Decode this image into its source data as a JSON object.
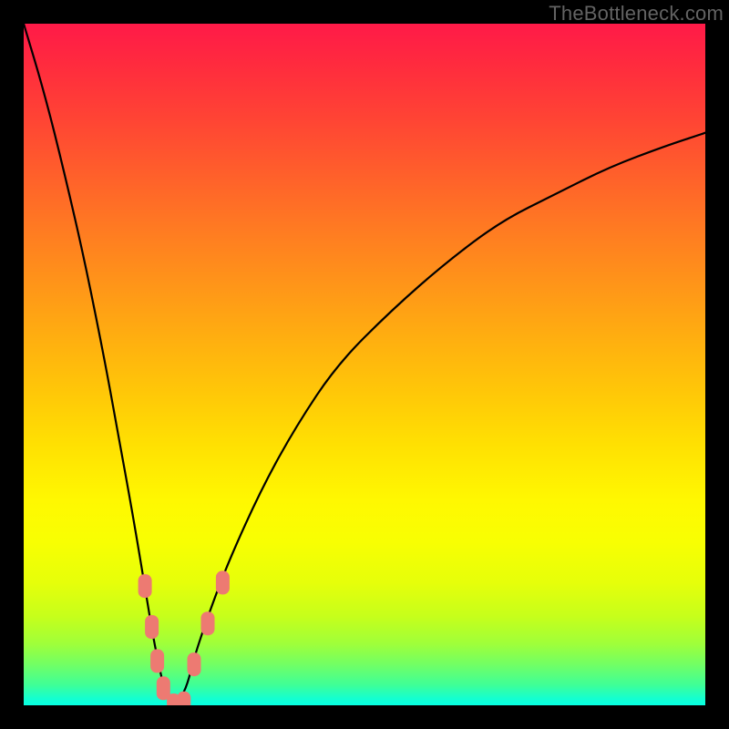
{
  "watermark": {
    "text": "TheBottleneck.com"
  },
  "chart_data": {
    "type": "line",
    "title": "",
    "xlabel": "",
    "ylabel": "",
    "xlim": [
      0,
      100
    ],
    "ylim": [
      0,
      100
    ],
    "grid": false,
    "legend": false,
    "description": "V-shaped bottleneck curve (black) over rainbow gradient; minimum near x≈22.",
    "series": [
      {
        "name": "bottleneck-curve",
        "color": "#000000",
        "x": [
          0,
          3,
          6,
          9,
          12,
          14,
          16,
          18,
          19,
          20,
          21,
          22,
          23,
          24,
          25,
          27,
          30,
          35,
          40,
          46,
          54,
          62,
          70,
          78,
          86,
          94,
          100
        ],
        "y": [
          100,
          90,
          78,
          65,
          50,
          39,
          28,
          16,
          10,
          5,
          1,
          0,
          1,
          3,
          7,
          13,
          21,
          32,
          41,
          50,
          58,
          65,
          71,
          75,
          79,
          82,
          84
        ]
      }
    ],
    "markers": {
      "name": "highlight-dots",
      "color": "#ed7a72",
      "shape": "rounded-rect",
      "points": [
        {
          "x": 17.8,
          "y": 17.5
        },
        {
          "x": 18.8,
          "y": 11.5
        },
        {
          "x": 19.6,
          "y": 6.5
        },
        {
          "x": 20.5,
          "y": 2.5
        },
        {
          "x": 22.0,
          "y": 0.0
        },
        {
          "x": 23.5,
          "y": 0.3
        },
        {
          "x": 25.0,
          "y": 6.0
        },
        {
          "x": 27.0,
          "y": 12.0
        },
        {
          "x": 29.2,
          "y": 18.0
        }
      ]
    }
  }
}
